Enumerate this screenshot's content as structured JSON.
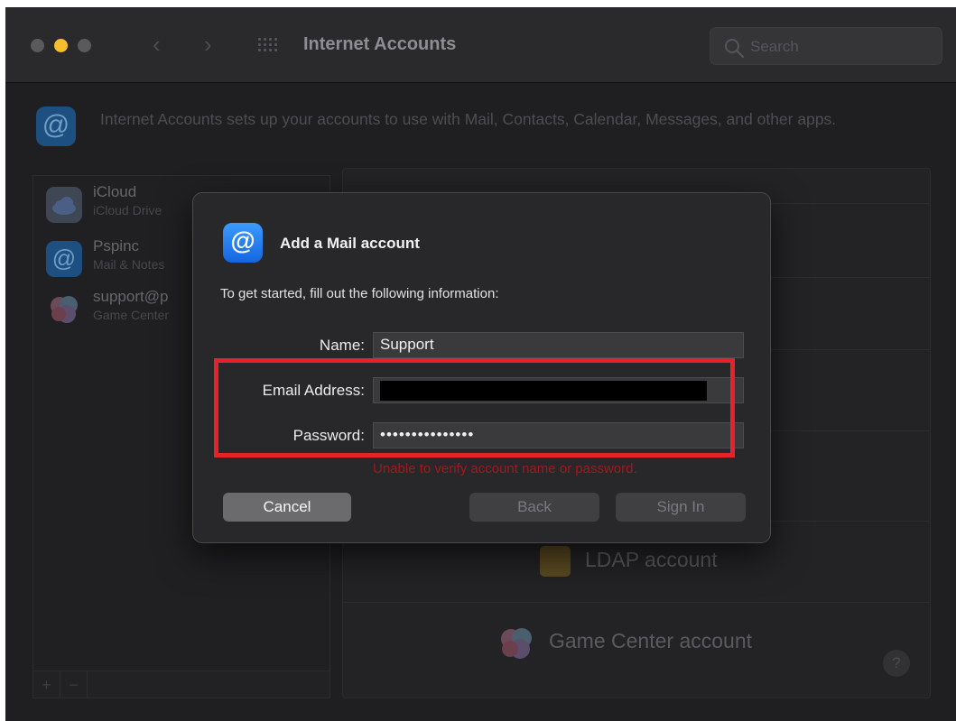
{
  "window": {
    "title": "Internet Accounts",
    "search": {
      "placeholder": "Search"
    }
  },
  "header": {
    "description": "Internet Accounts sets up your accounts to use with Mail, Contacts, Calendar, Messages, and other apps."
  },
  "accounts": [
    {
      "name": "iCloud",
      "detail": "iCloud Drive"
    },
    {
      "name": "Pspinc",
      "detail": "Mail & Notes"
    },
    {
      "name": "support@p",
      "detail": "Game Center"
    }
  ],
  "list_footer": {
    "add": "+",
    "remove": "−"
  },
  "providers": {
    "ldap": "LDAP account",
    "game_center": "Game Center account",
    "help": "?"
  },
  "dialog": {
    "title": "Add a Mail account",
    "instructions": "To get started, fill out the following information:",
    "name_label": "Name:",
    "name_value": "Support",
    "email_label": "Email Address:",
    "password_label": "Password:",
    "password_value": "•••••••••••••••",
    "error": "Unable to verify account name or password.",
    "cancel": "Cancel",
    "back": "Back",
    "sign_in": "Sign In"
  },
  "colors": {
    "window_bg": "#1f1f21",
    "dialog_bg": "#28282a",
    "highlight": "#e6222a",
    "error": "#a3181c",
    "minimize": "#f5be2d"
  },
  "icons": {
    "at": "@",
    "back": "‹",
    "forward": "›"
  }
}
